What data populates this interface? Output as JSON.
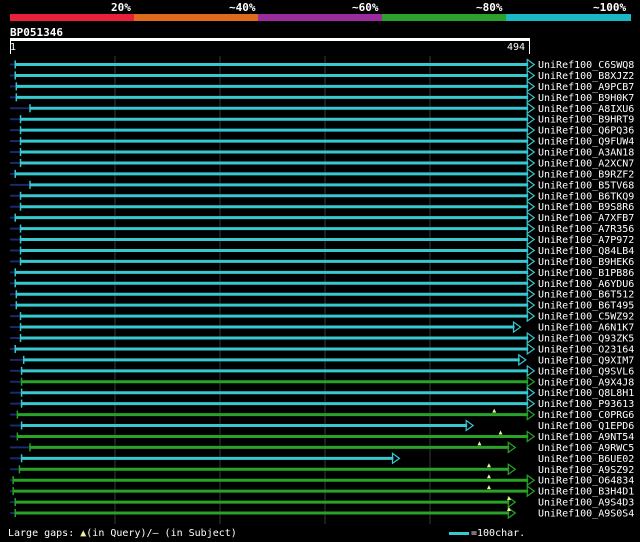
{
  "header": {
    "pct_labels": [
      "20%",
      "~40%",
      "~60%",
      "~80%",
      "~100%"
    ],
    "band_colors": [
      "#e8203a",
      "#e06a1c",
      "#9a2c9e",
      "#2ca02c",
      "#19b8c4"
    ]
  },
  "query": {
    "name": "BP051346",
    "start": "1",
    "end": "494"
  },
  "colors": {
    "cyan": "#37c8d0",
    "green": "#27a327",
    "navy": "#1a2a6c",
    "grid": "#3a3a3a",
    "gap_marker": "#f5f0a0"
  },
  "hits": [
    {
      "label": "UniRef100_C6SWQ8",
      "start": 5,
      "end": 498,
      "color": "cyan"
    },
    {
      "label": "UniRef100_B8XJZ2",
      "start": 5,
      "end": 498,
      "color": "cyan"
    },
    {
      "label": "UniRef100_A9PCB7",
      "start": 6,
      "end": 498,
      "color": "cyan"
    },
    {
      "label": "UniRef100_B9H0K7",
      "start": 6,
      "end": 498,
      "color": "cyan"
    },
    {
      "label": "UniRef100_A8IXU6",
      "start": 19,
      "end": 498,
      "color": "cyan"
    },
    {
      "label": "UniRef100_B9HRT9",
      "start": 10,
      "end": 498,
      "color": "cyan"
    },
    {
      "label": "UniRef100_Q6PQ36",
      "start": 10,
      "end": 498,
      "color": "cyan"
    },
    {
      "label": "UniRef100_Q9FUW4",
      "start": 10,
      "end": 498,
      "color": "cyan"
    },
    {
      "label": "UniRef100_A3AN18",
      "start": 10,
      "end": 498,
      "color": "cyan"
    },
    {
      "label": "UniRef100_A2XCN7",
      "start": 10,
      "end": 498,
      "color": "cyan"
    },
    {
      "label": "UniRef100_B9RZF2",
      "start": 5,
      "end": 498,
      "color": "cyan"
    },
    {
      "label": "UniRef100_B5TV68",
      "start": 19,
      "end": 498,
      "color": "cyan"
    },
    {
      "label": "UniRef100_B6TKQ9",
      "start": 10,
      "end": 498,
      "color": "cyan"
    },
    {
      "label": "UniRef100_B9S8R6",
      "start": 10,
      "end": 498,
      "color": "cyan"
    },
    {
      "label": "UniRef100_A7XFB7",
      "start": 5,
      "end": 498,
      "color": "cyan"
    },
    {
      "label": "UniRef100_A7R356",
      "start": 10,
      "end": 498,
      "color": "cyan"
    },
    {
      "label": "UniRef100_A7P972",
      "start": 10,
      "end": 498,
      "color": "cyan"
    },
    {
      "label": "UniRef100_Q84LB4",
      "start": 10,
      "end": 498,
      "color": "cyan"
    },
    {
      "label": "UniRef100_B9HEK6",
      "start": 10,
      "end": 498,
      "color": "cyan"
    },
    {
      "label": "UniRef100_B1PB86",
      "start": 5,
      "end": 498,
      "color": "cyan"
    },
    {
      "label": "UniRef100_A6YDU6",
      "start": 5,
      "end": 498,
      "color": "cyan"
    },
    {
      "label": "UniRef100_B6T512",
      "start": 6,
      "end": 498,
      "color": "cyan"
    },
    {
      "label": "UniRef100_B6T495",
      "start": 6,
      "end": 498,
      "color": "cyan"
    },
    {
      "label": "UniRef100_C5WZ92",
      "start": 10,
      "end": 498,
      "color": "cyan"
    },
    {
      "label": "UniRef100_A6N1K7",
      "start": 10,
      "end": 485,
      "color": "cyan"
    },
    {
      "label": "UniRef100_Q93ZK5",
      "start": 10,
      "end": 498,
      "color": "cyan"
    },
    {
      "label": "UniRef100_O23164",
      "start": 5,
      "end": 498,
      "color": "cyan"
    },
    {
      "label": "UniRef100_Q9XIM7",
      "start": 13,
      "end": 490,
      "color": "cyan"
    },
    {
      "label": "UniRef100_Q9SVL6",
      "start": 11,
      "end": 498,
      "color": "cyan"
    },
    {
      "label": "UniRef100_A9X4J8",
      "start": 11,
      "end": 498,
      "color": "green"
    },
    {
      "label": "UniRef100_Q8L8H1",
      "start": 11,
      "end": 498,
      "color": "cyan"
    },
    {
      "label": "UniRef100_P93613",
      "start": 11,
      "end": 498,
      "color": "cyan"
    },
    {
      "label": "UniRef100_C0PRG6",
      "start": 7,
      "end": 498,
      "color": "green",
      "gap": 460
    },
    {
      "label": "UniRef100_Q1EPD6",
      "start": 11,
      "end": 440,
      "color": "cyan"
    },
    {
      "label": "UniRef100_A9NT54",
      "start": 7,
      "end": 498,
      "color": "green",
      "gap": 466
    },
    {
      "label": "UniRef100_A9RWC5",
      "start": 19,
      "end": 480,
      "color": "green",
      "gap": 446
    },
    {
      "label": "UniRef100_B6UE02",
      "start": 11,
      "end": 370,
      "color": "cyan"
    },
    {
      "label": "UniRef100_A9SZ92",
      "start": 9,
      "end": 480,
      "color": "green",
      "gap": 455
    },
    {
      "label": "UniRef100_O64834",
      "start": 3,
      "end": 498,
      "color": "green",
      "gap": 455
    },
    {
      "label": "UniRef100_B3H4D1",
      "start": 3,
      "end": 498,
      "color": "green",
      "gap": 455
    },
    {
      "label": "UniRef100_A9S4D3",
      "start": 5,
      "end": 480,
      "color": "green",
      "gap": 474
    },
    {
      "label": "UniRef100_A9S0S4",
      "start": 5,
      "end": 480,
      "color": "green",
      "gap": 474
    }
  ],
  "footer": {
    "prefix": "Large gaps: ",
    "gap_symbol": "▲",
    "middle": "(in Query)/– (in Subject)",
    "legend_text": "=100char."
  }
}
